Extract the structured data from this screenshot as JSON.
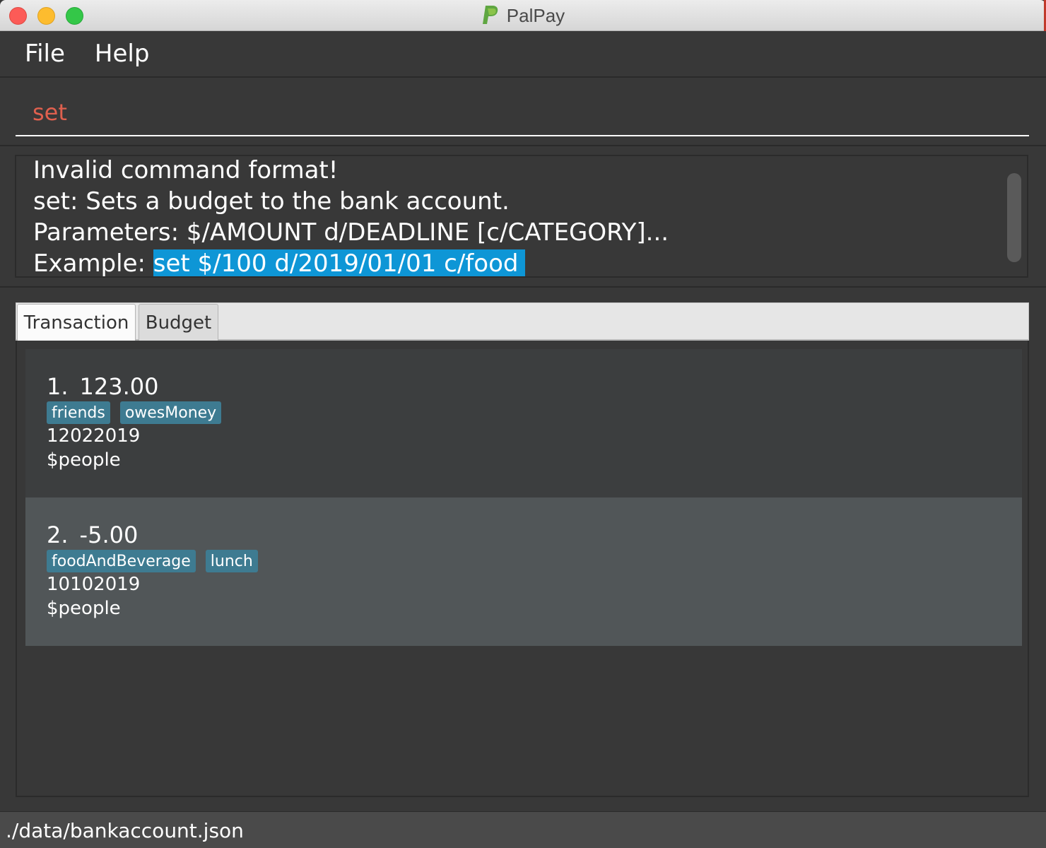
{
  "window": {
    "title": "PalPay"
  },
  "menu": {
    "items": [
      "File",
      "Help"
    ]
  },
  "command_box": {
    "value": "set"
  },
  "result": {
    "line1": "Invalid command format!",
    "line2": "set: Sets a budget to the bank account.",
    "line3": "Parameters: $/AMOUNT d/DEADLINE [c/CATEGORY]...",
    "line4_prefix": "Example: ",
    "line4_highlight": "set $/100 d/2019/01/01 c/food"
  },
  "tabs": [
    {
      "label": "Transaction",
      "active": true
    },
    {
      "label": "Budget",
      "active": false
    }
  ],
  "transactions": [
    {
      "index": "1.",
      "amount": "123.00",
      "tags": [
        "friends",
        "owesMoney"
      ],
      "date": "12022019",
      "description": "$people"
    },
    {
      "index": "2.",
      "amount": "-5.00",
      "tags": [
        "foodAndBeverage",
        "lunch"
      ],
      "date": "10102019",
      "description": "$people"
    }
  ],
  "status_bar": {
    "path": "./data/bankaccount.json"
  },
  "colors": {
    "background": "#383838",
    "command_text": "#e0604e",
    "highlight": "#0e96d6",
    "tag": "#3e7b91",
    "card_selected": "#515658"
  },
  "icons": [
    "close-window-icon",
    "minimize-window-icon",
    "zoom-window-icon",
    "palpay-logo-icon"
  ]
}
